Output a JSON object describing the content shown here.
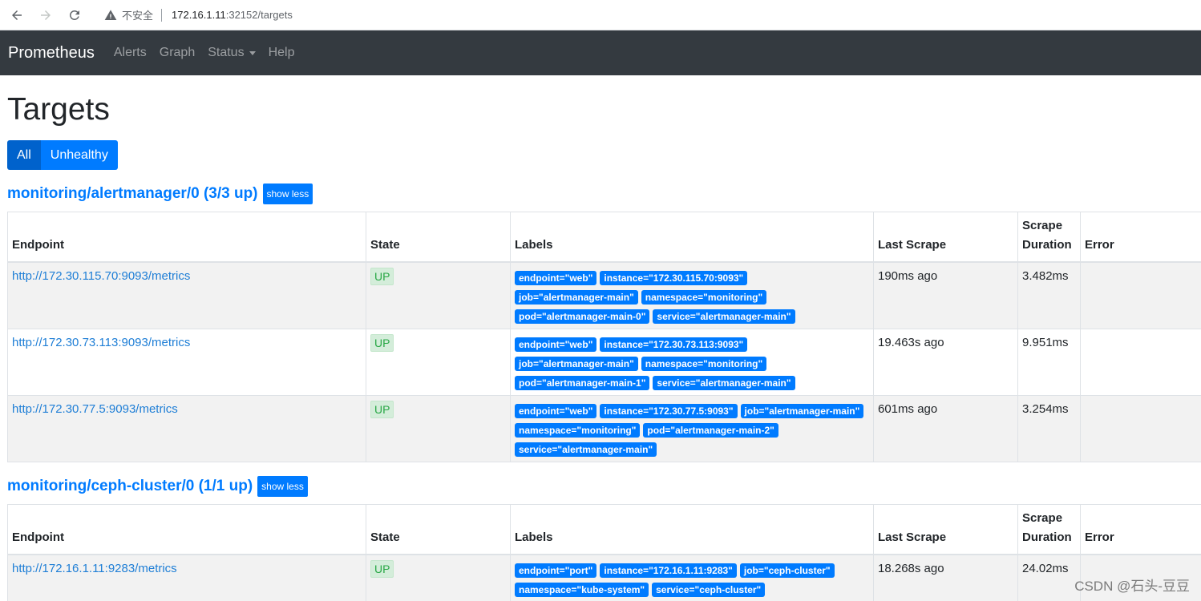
{
  "browser": {
    "insecure_label": "不安全",
    "url_host": "172.16.1.11",
    "url_path": ":32152/targets"
  },
  "navbar": {
    "brand": "Prometheus",
    "links": [
      "Alerts",
      "Graph",
      "Status",
      "Help"
    ]
  },
  "page": {
    "title": "Targets",
    "filters": [
      "All",
      "Unhealthy"
    ]
  },
  "table_headers": {
    "endpoint": "Endpoint",
    "state": "State",
    "labels": "Labels",
    "last_scrape": "Last Scrape",
    "scrape_duration_line1": "Scrape",
    "scrape_duration_line2": "Duration",
    "error": "Error"
  },
  "jobs": [
    {
      "title": "monitoring/alertmanager/0 (3/3 up)",
      "toggle": "show less",
      "targets": [
        {
          "endpoint": "http://172.30.115.70:9093/metrics",
          "state": "UP",
          "labels": [
            "endpoint=\"web\"",
            "instance=\"172.30.115.70:9093\"",
            "job=\"alertmanager-main\"",
            "namespace=\"monitoring\"",
            "pod=\"alertmanager-main-0\"",
            "service=\"alertmanager-main\""
          ],
          "last_scrape": "190ms ago",
          "duration": "3.482ms",
          "error": ""
        },
        {
          "endpoint": "http://172.30.73.113:9093/metrics",
          "state": "UP",
          "labels": [
            "endpoint=\"web\"",
            "instance=\"172.30.73.113:9093\"",
            "job=\"alertmanager-main\"",
            "namespace=\"monitoring\"",
            "pod=\"alertmanager-main-1\"",
            "service=\"alertmanager-main\""
          ],
          "last_scrape": "19.463s ago",
          "duration": "9.951ms",
          "error": ""
        },
        {
          "endpoint": "http://172.30.77.5:9093/metrics",
          "state": "UP",
          "labels": [
            "endpoint=\"web\"",
            "instance=\"172.30.77.5:9093\"",
            "job=\"alertmanager-main\"",
            "namespace=\"monitoring\"",
            "pod=\"alertmanager-main-2\"",
            "service=\"alertmanager-main\""
          ],
          "last_scrape": "601ms ago",
          "duration": "3.254ms",
          "error": ""
        }
      ]
    },
    {
      "title": "monitoring/ceph-cluster/0 (1/1 up)",
      "toggle": "show less",
      "targets": [
        {
          "endpoint": "http://172.16.1.11:9283/metrics",
          "state": "UP",
          "labels": [
            "endpoint=\"port\"",
            "instance=\"172.16.1.11:9283\"",
            "job=\"ceph-cluster\"",
            "namespace=\"kube-system\"",
            "service=\"ceph-cluster\""
          ],
          "last_scrape": "18.268s ago",
          "duration": "24.02ms",
          "error": ""
        }
      ]
    }
  ],
  "watermark": "CSDN @石头-豆豆"
}
